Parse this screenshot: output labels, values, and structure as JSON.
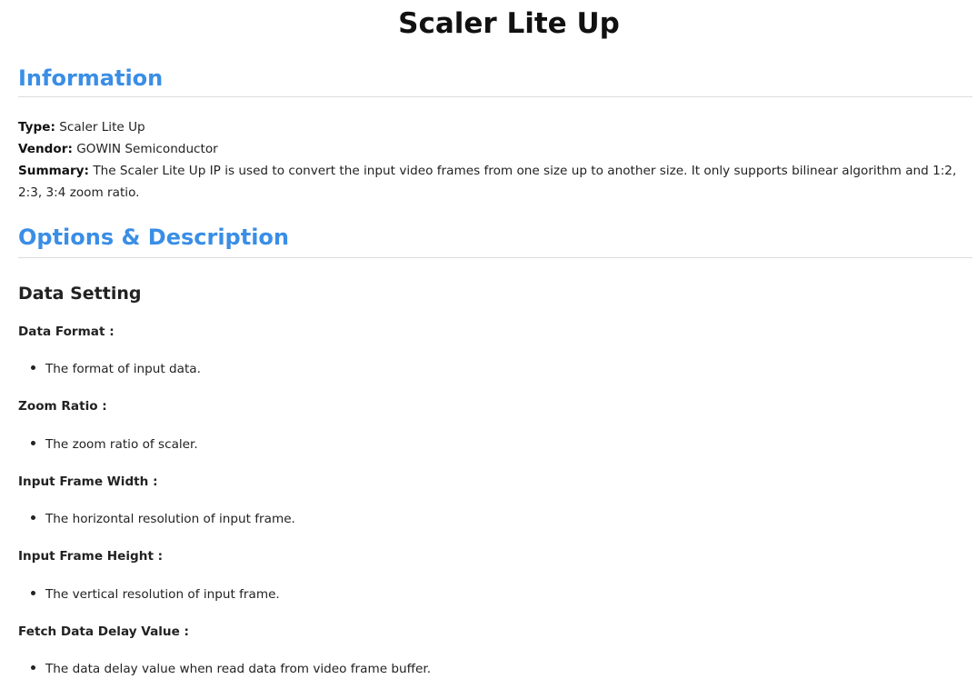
{
  "title": "Scaler Lite Up",
  "accent_color": "#3a8ee6",
  "information": {
    "heading": "Information",
    "type_label": "Type:",
    "type_value": "Scaler Lite Up",
    "vendor_label": "Vendor:",
    "vendor_value": "GOWIN Semiconductor",
    "summary_label": "Summary:",
    "summary_value": "The Scaler Lite Up IP is used to convert the input video frames from one size up to another size. It only supports bilinear algorithm and 1:2, 2:3, 3:4 zoom ratio."
  },
  "options": {
    "heading": "Options & Description",
    "group_title": "Data Setting",
    "items": [
      {
        "label": "Data Format :",
        "description": "The format of input data."
      },
      {
        "label": "Zoom Ratio :",
        "description": "The zoom ratio of scaler."
      },
      {
        "label": "Input Frame Width :",
        "description": "The horizontal resolution of input frame."
      },
      {
        "label": "Input Frame Height :",
        "description": "The vertical resolution of input frame."
      },
      {
        "label": "Fetch Data Delay Value :",
        "description": "The data delay value when read data from video frame buffer."
      }
    ]
  }
}
